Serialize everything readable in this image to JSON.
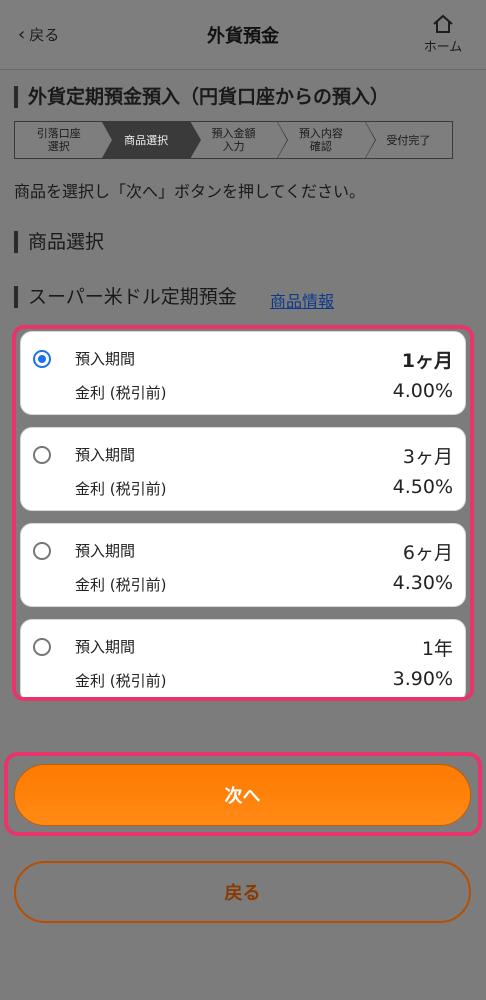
{
  "header": {
    "back_label": "戻る",
    "title": "外貨預金",
    "home_label": "ホーム"
  },
  "section_title": "外貨定期預金預入（円貨口座からの預入）",
  "steps": [
    {
      "label": "引落口座\n選択",
      "active": false
    },
    {
      "label": "商品選択",
      "active": true
    },
    {
      "label": "預入金額\n入力",
      "active": false
    },
    {
      "label": "預入内容\n確認",
      "active": false
    },
    {
      "label": "受付完了",
      "active": false
    }
  ],
  "instruction": "商品を選択し「次へ」ボタンを押してください。",
  "product_section_title": "商品選択",
  "product_name": "スーパー米ドル定期預金",
  "product_info_link": "商品情報",
  "options": [
    {
      "period_label": "預入期間",
      "period": "1ヶ月",
      "rate_label": "金利 (税引前)",
      "rate": "4.00%",
      "selected": true
    },
    {
      "period_label": "預入期間",
      "period": "3ヶ月",
      "rate_label": "金利 (税引前)",
      "rate": "4.50%",
      "selected": false
    },
    {
      "period_label": "預入期間",
      "period": "6ヶ月",
      "rate_label": "金利 (税引前)",
      "rate": "4.30%",
      "selected": false
    },
    {
      "period_label": "預入期間",
      "period": "1年",
      "rate_label": "金利 (税引前)",
      "rate": "3.90%",
      "selected": false
    }
  ],
  "buttons": {
    "next_label": "次へ",
    "back_label": "戻る"
  },
  "colors": {
    "accent": "#ff7a00",
    "highlight": "#e8336b",
    "radio_selected": "#1a73e8"
  }
}
